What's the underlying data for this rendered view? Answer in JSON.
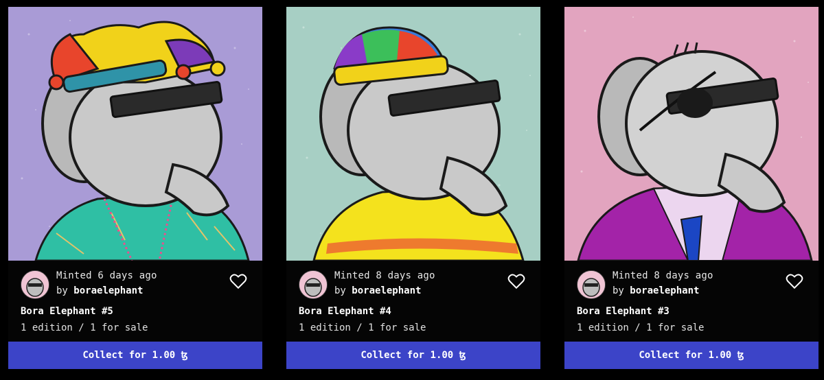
{
  "cards": [
    {
      "art_icon": "elephant-jester-hat-icon",
      "bg_color": "#a99bd6",
      "shirt_color": "#2fbfa4",
      "hat": "jester",
      "minted": "Minted 6 days ago",
      "by_prefix": "by",
      "creator": "boraelephant",
      "title": "Bora Elephant #5",
      "editions": "1 edition / 1 for sale",
      "collect_label": "Collect for 1.00 ꜩ"
    },
    {
      "art_icon": "elephant-beanie-icon",
      "bg_color": "#a7cfc4",
      "shirt_color": "#f4e21d",
      "hat": "beanie",
      "minted": "Minted 8 days ago",
      "by_prefix": "by",
      "creator": "boraelephant",
      "title": "Bora Elephant #4",
      "editions": "1 edition / 1 for sale",
      "collect_label": "Collect for 1.00 ꜩ"
    },
    {
      "art_icon": "elephant-eyepatch-suit-icon",
      "bg_color": "#e2a4bf",
      "shirt_color": "#a323a8",
      "hat": "none",
      "minted": "Minted 8 days ago",
      "by_prefix": "by",
      "creator": "boraelephant",
      "title": "Bora Elephant #3",
      "editions": "1 edition / 1 for sale",
      "collect_label": "Collect for 1.00 ꜩ"
    }
  ],
  "colors": {
    "button": "#3c44c8",
    "background": "#000000"
  }
}
